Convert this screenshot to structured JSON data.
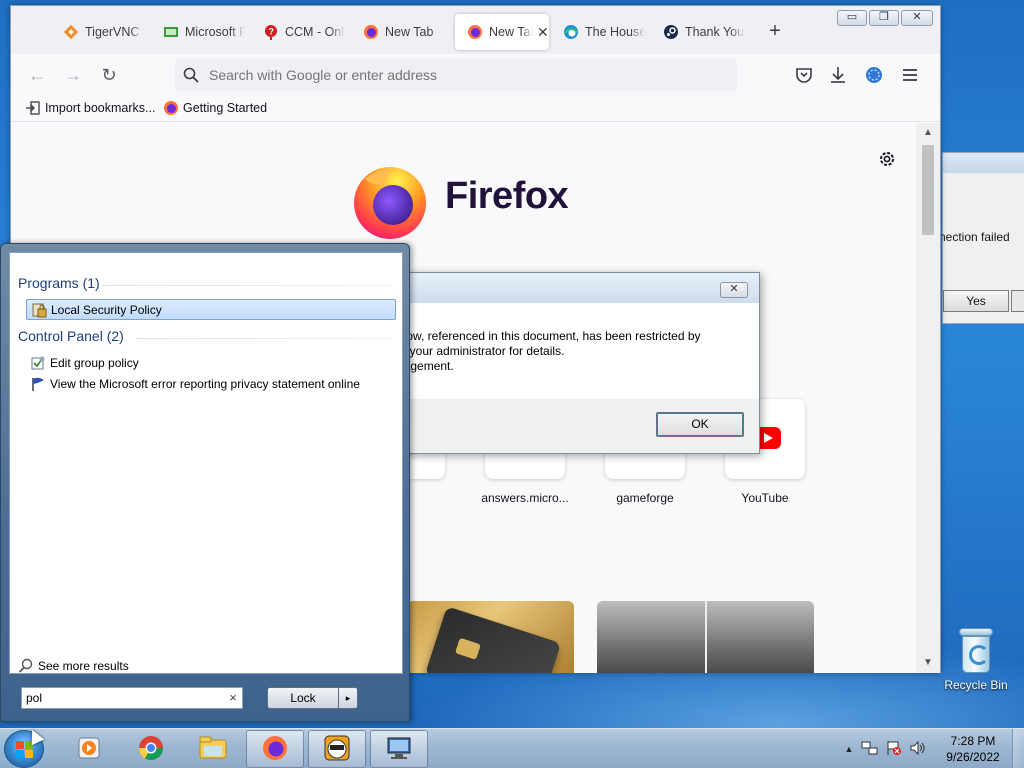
{
  "firefox": {
    "tabs": [
      {
        "label": "TigerVNC",
        "icon": "tigervnc-icon",
        "active": false
      },
      {
        "label": "Microsoft F",
        "icon": "microsoft-icon",
        "active": false
      },
      {
        "label": "CCM - Onl",
        "icon": "ccm-icon",
        "active": false
      },
      {
        "label": "New Tab",
        "icon": "firefox-icon",
        "active": false
      },
      {
        "label": "New Tab",
        "icon": "firefox-icon",
        "active": true
      },
      {
        "label": "The House",
        "icon": "edge-icon",
        "active": false
      },
      {
        "label": "Thank You",
        "icon": "steam-icon",
        "active": false
      }
    ],
    "new_tab_symbol": "+",
    "window_controls": {
      "minimize": "▭",
      "maximize": "❐",
      "close": "✕"
    },
    "urlbar": {
      "placeholder": "Search with Google or enter address",
      "value": ""
    },
    "bookmarks": [
      {
        "label": "Import bookmarks...",
        "icon": "import-icon"
      },
      {
        "label": "Getting Started",
        "icon": "firefox-icon"
      }
    ],
    "home": {
      "brand": "Firefox",
      "shortcuts": [
        {
          "label": "et"
        },
        {
          "label": "answers.micro..."
        },
        {
          "label": "gameforge"
        },
        {
          "label": "YouTube"
        }
      ]
    }
  },
  "error_dialog": {
    "close_symbol": "✕",
    "message_lines": [
      "elow, referenced in this document, has been restricted by",
      "ct your administrator for details.",
      "nagement."
    ],
    "ok_label": "OK"
  },
  "background_dialog": {
    "message": "nection failed",
    "yes_label": "Yes"
  },
  "start_menu": {
    "programs_heading": "Programs (1)",
    "programs": [
      {
        "label": "Local Security Policy",
        "icon": "security-policy-icon",
        "selected": true
      }
    ],
    "control_panel_heading": "Control Panel (2)",
    "control_panel": [
      {
        "label": "Edit group policy",
        "icon": "group-policy-icon"
      },
      {
        "label": "View the Microsoft error reporting privacy statement online",
        "icon": "flag-icon"
      }
    ],
    "see_more": "See more results",
    "search_value": "pol",
    "clear_symbol": "×",
    "lock_label": "Lock",
    "lock_arrow": "▸"
  },
  "desktop": {
    "recycle_bin_label": "Recycle Bin"
  },
  "taskbar": {
    "pinned": [
      "media-player-icon",
      "chrome-icon",
      "file-explorer-icon",
      "firefox-icon",
      "game-app-icon",
      "remote-desktop-icon"
    ],
    "clock": {
      "time": "7:28 PM",
      "date": "9/26/2022"
    },
    "tray_arrow": "▲"
  },
  "colors": {
    "firefox_purple": "#20123a",
    "selection_blue": "#c1dcfc",
    "start_heading_blue": "#1e3f7a",
    "desktop_blue": "#1f6fc4"
  }
}
